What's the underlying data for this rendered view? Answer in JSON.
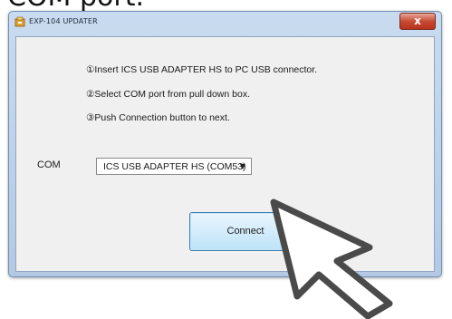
{
  "caption": "COM port.",
  "window": {
    "title": "EXP-104 UPDATER",
    "close_glyph": "x"
  },
  "instructions": [
    "①Insert ICS USB ADAPTER HS to PC USB connector.",
    "②Select COM port from pull down box.",
    "③Push Connection button to next."
  ],
  "com": {
    "label": "COM",
    "selected": "ICS USB ADAPTER HS (COM53)"
  },
  "connect_button": "Connect",
  "icons": {
    "app": "updater-app-icon",
    "cursor": "pointer-arrow-icon",
    "dropdown": "chevron-down-icon"
  }
}
